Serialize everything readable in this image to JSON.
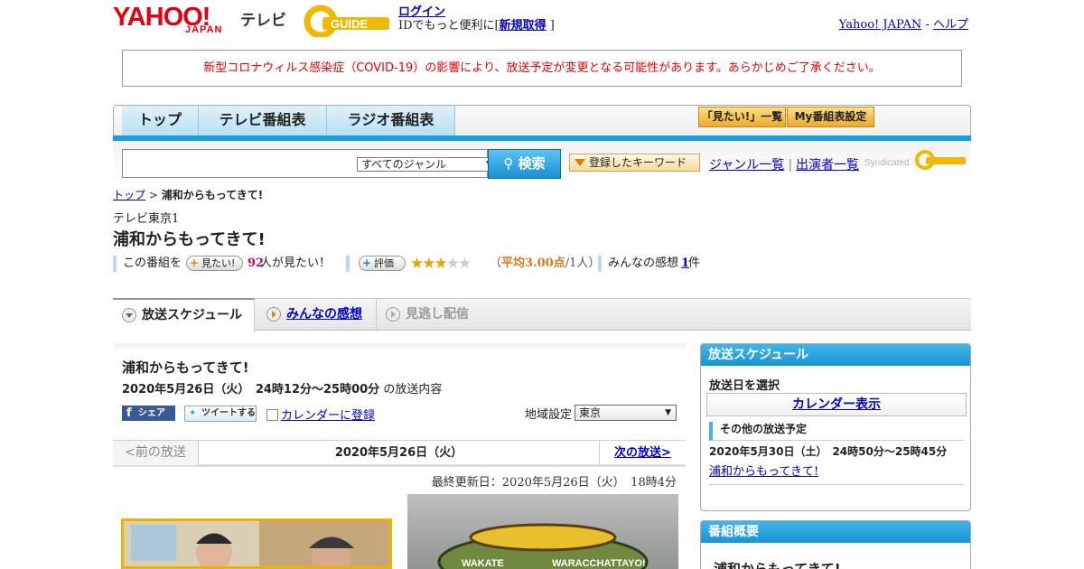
{
  "header": {
    "logo_yahoo": "YAHOO!",
    "logo_japan": "JAPAN",
    "logo_tv": "テレビ",
    "logo_gguide": "GUIDE",
    "login": "ログイン",
    "id_prefix": "IDでもっと便利に[",
    "signup": "新規取得",
    "id_suffix": "]",
    "yahoo_japan": "Yahoo! JAPAN",
    "dash": "-",
    "help": "ヘルプ"
  },
  "notice": "新型コロナウィルス感染症（COVID-19）の影響により、放送予定が変更となる可能性があります。あらかじめご了承ください。",
  "nav": {
    "tabs": [
      "トップ",
      "テレビ番組表",
      "ラジオ番組表"
    ],
    "want_list": "「見たい!」一覧",
    "my_settings": "My番組表設定"
  },
  "search": {
    "genre": "すべてのジャンル",
    "button": "検索",
    "keyword_btn": "登録したキーワード",
    "genre_list": "ジャンル一覧",
    "sep": "|",
    "performer_list": "出演者一覧",
    "syndicated": "Syndicated"
  },
  "breadcrumb": {
    "top": "トップ",
    "sep": ">",
    "current": "浦和からもってきて!"
  },
  "program": {
    "station": "テレビ東京1",
    "title": "浦和からもってきて!",
    "meta_prefix": "この番組を",
    "want_btn": "見たい!",
    "want_count": "92",
    "want_suffix": "人が見たい！",
    "rate_btn": "評価",
    "rating": 3,
    "rating_max": 5,
    "avg_open": "（",
    "avg_value": "平均3.00点",
    "avg_people": "/1人）",
    "reviews_label": "みんなの感想",
    "reviews_count": "1",
    "reviews_suffix": "件"
  },
  "tabs": [
    "放送スケジュール",
    "みんなの感想",
    "見逃し配信"
  ],
  "main": {
    "title": "浦和からもってきて!",
    "time": "2020年5月26日（火）　24時12分～25時00分",
    "time_suffix": "の放送内容",
    "share_fb": "シェア",
    "share_tw": "ツイートする",
    "calendar": "カレンダーに登録",
    "region_label": "地域設定",
    "region": "東京",
    "prev": "<前の放送",
    "date": "2020年5月26日（火）",
    "next": "次の放送>",
    "updated": "最終更新日：2020年5月26日（火）　18時4分",
    "logo_text_1": "WAKATE",
    "logo_text_2": "WARACCHATTAYO!"
  },
  "sidebar": {
    "schedule_head": "放送スケジュール",
    "select_date": "放送日を選択",
    "calendar_btn": "カレンダー表示",
    "other_head": "その他の放送予定",
    "other_time": "2020年5月30日（土）　24時50分～25時45分",
    "other_link": "浦和からもってきて!",
    "summary_head": "番組概要",
    "summary_title": "浦和からもってきて!"
  },
  "colors": {
    "accent": "#1a9dd9",
    "notice": "#e00000",
    "yahoo": "#e00012",
    "star": "#e8a400"
  }
}
